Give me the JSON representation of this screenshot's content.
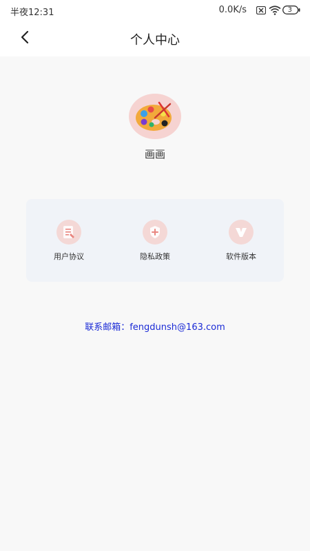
{
  "status_bar": {
    "time": "半夜12:31",
    "speed": "0.0K/s",
    "battery": "3"
  },
  "navbar": {
    "title": "个人中心"
  },
  "profile": {
    "name": "画画"
  },
  "menu": [
    {
      "label": "用户协议",
      "icon": "document-icon"
    },
    {
      "label": "隐私政策",
      "icon": "shield-icon"
    },
    {
      "label": "软件版本",
      "icon": "version-v-icon"
    }
  ],
  "contact": {
    "text": "联系邮箱：fengdunsh@163.com"
  },
  "colors": {
    "icon_bg": "#f4d8d6",
    "icon_fg": "#e98680",
    "card_bg": "#f0f3f8",
    "contact": "#1a2ad6"
  }
}
